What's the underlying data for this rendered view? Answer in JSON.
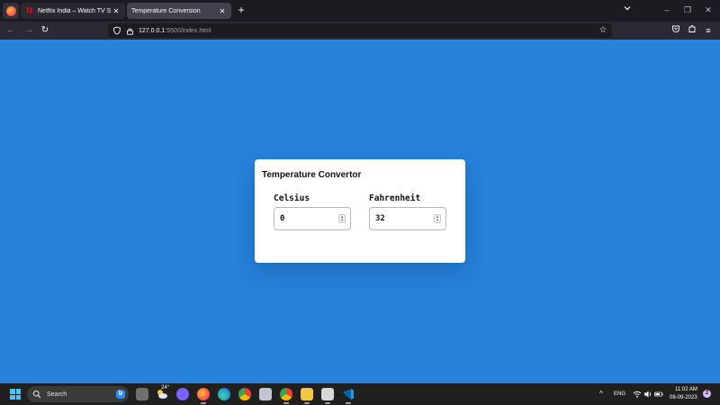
{
  "browser": {
    "tabs": [
      {
        "title": "Netflix India – Watch TV Shows Online, Watch Movies Online",
        "favicon": "netflix-icon",
        "active": false
      },
      {
        "title": "Temperature Conversion",
        "favicon": "none",
        "active": true
      }
    ],
    "new_tab_symbol": "+",
    "url": {
      "host": "127.0.0.1",
      "path": ":5500/index.html"
    }
  },
  "page": {
    "background_color": "#2682db",
    "card": {
      "title": "Temperature Convertor",
      "celsius": {
        "label": "Celsius",
        "value": "0"
      },
      "fahrenheit": {
        "label": "Fahrenheit",
        "value": "32"
      }
    }
  },
  "taskbar": {
    "search_label": "Search",
    "weather_temp": "24°",
    "tray": {
      "language": "ENG",
      "time": "11:02 AM",
      "date": "08-09-2023",
      "notification_count": "2"
    }
  }
}
